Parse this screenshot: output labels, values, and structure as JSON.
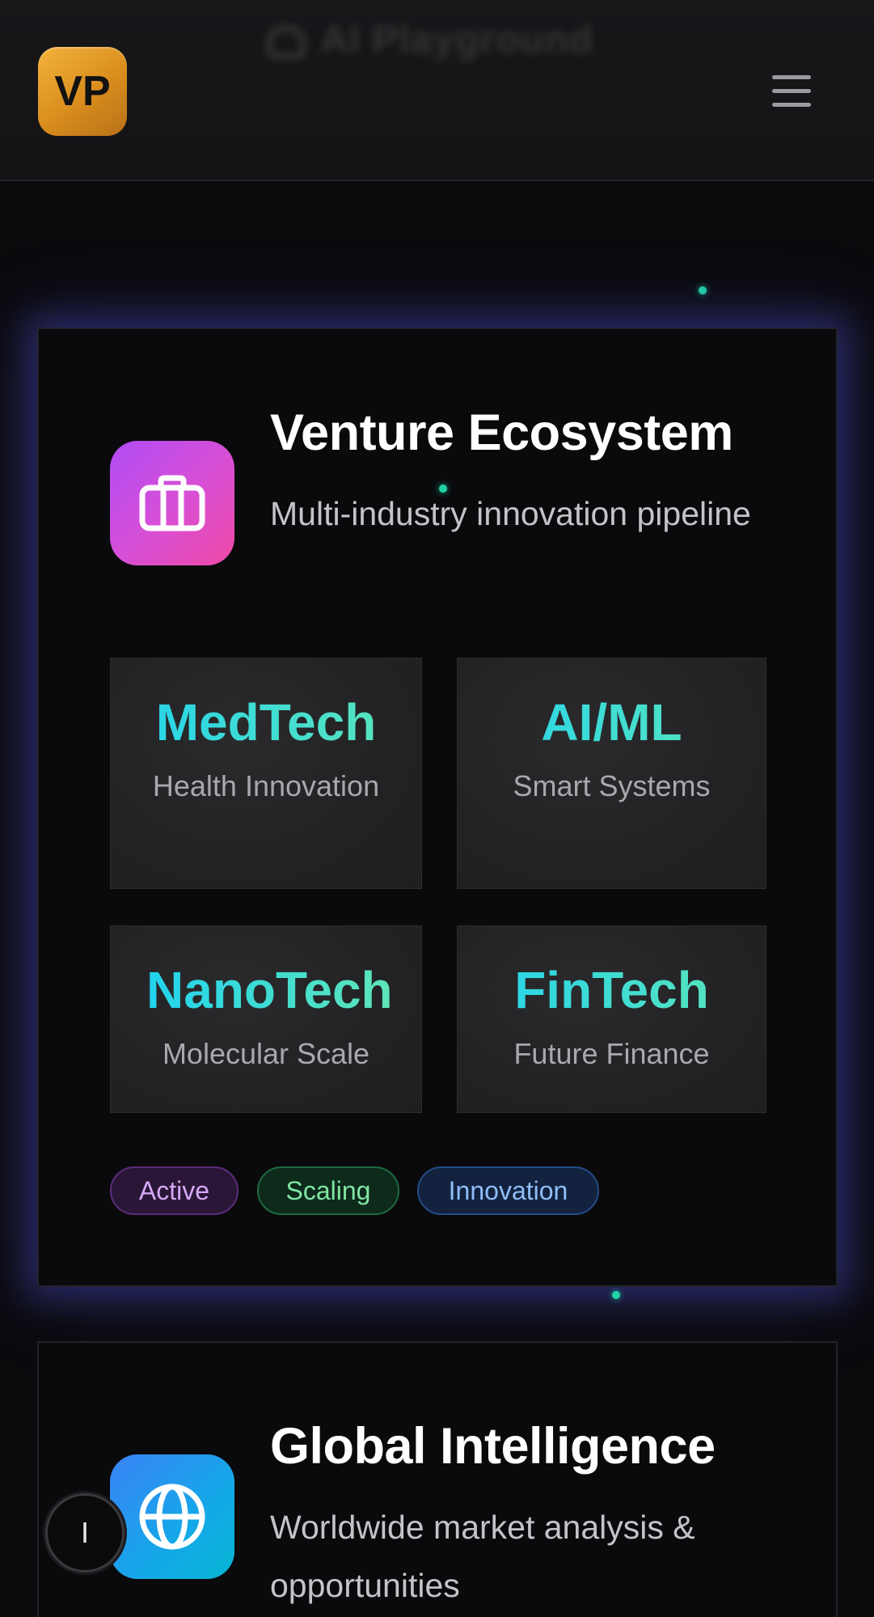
{
  "header": {
    "ghost_title": "AI Playground",
    "logo_text": "VP",
    "menu_icon": "hamburger-menu-icon"
  },
  "cards": [
    {
      "title": "Venture Ecosystem",
      "subtitle": "Multi-industry innovation pipeline",
      "icon": "briefcase-icon",
      "icon_gradient": [
        "#b04cf5",
        "#ef4aa6"
      ],
      "tiles": [
        {
          "title": "MedTech",
          "subtitle": "Health Innovation"
        },
        {
          "title": "AI/ML",
          "subtitle": "Smart Systems"
        },
        {
          "title": "NanoTech",
          "subtitle": "Molecular Scale"
        },
        {
          "title": "FinTech",
          "subtitle": "Future Finance"
        }
      ],
      "badges": [
        {
          "label": "Active",
          "color": "#d6a8f5"
        },
        {
          "label": "Scaling",
          "color": "#7fe6a4"
        },
        {
          "label": "Innovation",
          "color": "#90bdf7"
        }
      ]
    },
    {
      "title": "Global Intelligence",
      "subtitle": "Worldwide market analysis & opportunities",
      "icon": "globe-icon",
      "icon_gradient": [
        "#3b82f6",
        "#06b6d4"
      ]
    }
  ],
  "floating_button": {
    "label": "I"
  },
  "colors": {
    "background": "#0b0b0e",
    "accent_teal": "#22d3ee",
    "accent_green": "#5ee6b8",
    "logo_gold": "#f3b33d"
  }
}
